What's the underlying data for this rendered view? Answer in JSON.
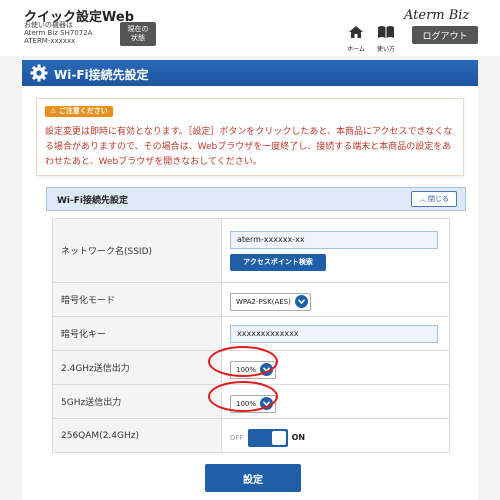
{
  "header": {
    "app_title": "クイック設定Web",
    "device_lines": [
      "お使いの機器は",
      "Aterm Biz SH7072A",
      "ATERM-xxxxxx"
    ],
    "status_button": [
      "現在の",
      "状態"
    ],
    "brand": "Aterm Biz",
    "nav_home": "ホーム",
    "nav_manual": "使い方",
    "logout": "ログアウト"
  },
  "page": {
    "title": "Wi-Fi接続先設定"
  },
  "notice": {
    "badge": "ご注意ください",
    "text": "設定変更は即時に有効となります。［設定］ボタンをクリックしたあと、本商品にアクセスできなくなる場合がありますので、その場合は、Webブラウザを一度終了し、接続する端末と本商品の設定をあわせたあと、Webブラウザを開きなおしてください。"
  },
  "section": {
    "title": "Wi-Fi接続先設定",
    "collapse_label": "閉じる"
  },
  "fields": {
    "ssid": {
      "label": "ネットワーク名(SSID)",
      "value": "aterm-xxxxxx-xx",
      "ap_search": "アクセスポイント検索"
    },
    "encryption": {
      "label": "暗号化モード",
      "value": "WPA2-PSK(AES)"
    },
    "key": {
      "label": "暗号化キー",
      "value": "xxxxxxxxxxxxx"
    },
    "power24": {
      "label": "2.4GHz送信出力",
      "value": "100%"
    },
    "power5": {
      "label": "5GHz送信出力",
      "value": "100%"
    },
    "qam": {
      "label": "256QAM(2.4GHz)",
      "off": "OFF",
      "on": "ON",
      "state": "on"
    }
  },
  "actions": {
    "save": "設定"
  },
  "colors": {
    "accent": "#1f5fa8",
    "highlight": "#e01b1b",
    "notice_text": "#c0392b",
    "badge": "#e9901c"
  }
}
